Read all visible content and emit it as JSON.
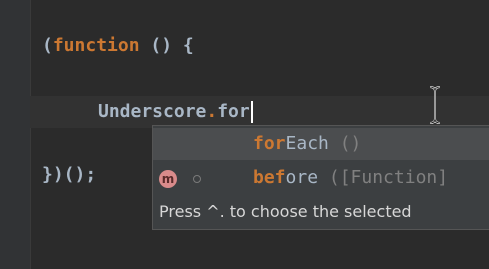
{
  "code": {
    "line1": {
      "open_paren": "(",
      "keyword": "function",
      "rest": " () {"
    },
    "line2": {
      "object": "Underscore",
      "dot": ".",
      "typed": "for"
    },
    "line3": {
      "text": "})();"
    }
  },
  "completion": {
    "items": [
      {
        "match": "for",
        "rest": "Each",
        "signature": " ()"
      },
      {
        "badge": "m",
        "match": "bef",
        "rest": "ore",
        "signature": " ([Function]"
      }
    ],
    "hint": "Press ^. to choose the selected"
  }
}
